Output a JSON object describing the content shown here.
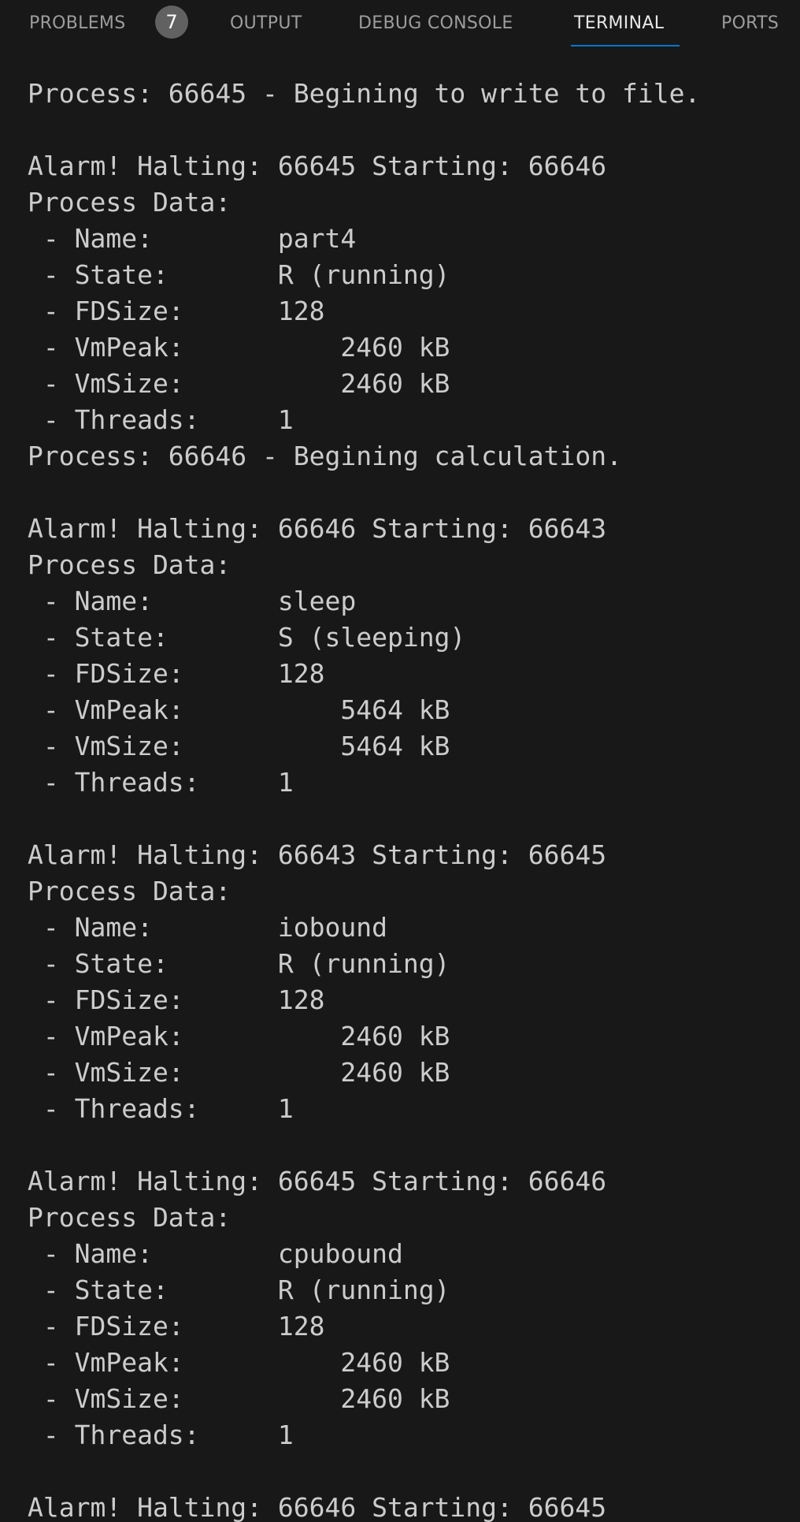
{
  "tabs": {
    "problems": "PROBLEMS",
    "problems_count": "7",
    "output": "OUTPUT",
    "debug_console": "DEBUG CONSOLE",
    "terminal": "TERMINAL",
    "ports": "PORTS",
    "active": "TERMINAL"
  },
  "terminal": {
    "lines": [
      "Process: 66645 - Begining to write to file.",
      "",
      "Alarm! Halting: 66645 Starting: 66646",
      "Process Data:",
      " - Name:        part4",
      " - State:       R (running)",
      " - FDSize:      128",
      " - VmPeak:          2460 kB",
      " - VmSize:          2460 kB",
      " - Threads:     1",
      "Process: 66646 - Begining calculation.",
      "",
      "Alarm! Halting: 66646 Starting: 66643",
      "Process Data:",
      " - Name:        sleep",
      " - State:       S (sleeping)",
      " - FDSize:      128",
      " - VmPeak:          5464 kB",
      " - VmSize:          5464 kB",
      " - Threads:     1",
      "",
      "Alarm! Halting: 66643 Starting: 66645",
      "Process Data:",
      " - Name:        iobound",
      " - State:       R (running)",
      " - FDSize:      128",
      " - VmPeak:          2460 kB",
      " - VmSize:          2460 kB",
      " - Threads:     1",
      "",
      "Alarm! Halting: 66645 Starting: 66646",
      "Process Data:",
      " - Name:        cpubound",
      " - State:       R (running)",
      " - FDSize:      128",
      " - VmPeak:          2460 kB",
      " - VmSize:          2460 kB",
      " - Threads:     1",
      "",
      "Alarm! Halting: 66646 Starting: 66645"
    ]
  }
}
